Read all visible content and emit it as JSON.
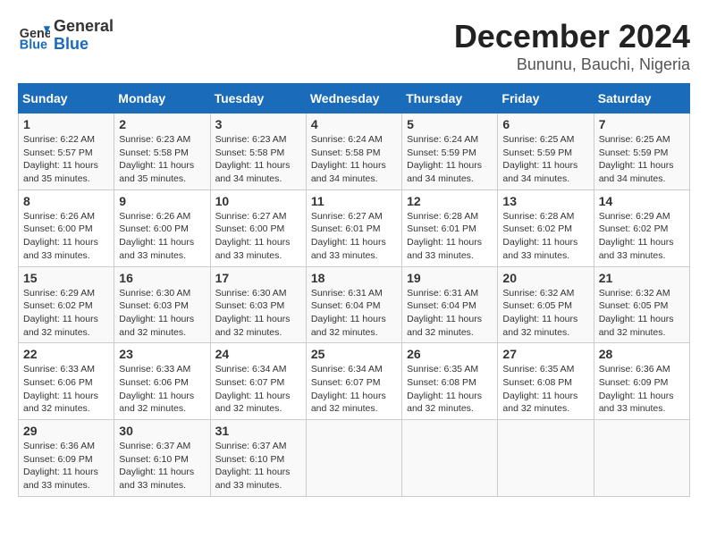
{
  "header": {
    "logo_line1": "General",
    "logo_line2": "Blue",
    "title": "December 2024",
    "subtitle": "Bununu, Bauchi, Nigeria"
  },
  "weekdays": [
    "Sunday",
    "Monday",
    "Tuesday",
    "Wednesday",
    "Thursday",
    "Friday",
    "Saturday"
  ],
  "weeks": [
    [
      {
        "day": "1",
        "sunrise": "Sunrise: 6:22 AM",
        "sunset": "Sunset: 5:57 PM",
        "daylight": "Daylight: 11 hours and 35 minutes."
      },
      {
        "day": "2",
        "sunrise": "Sunrise: 6:23 AM",
        "sunset": "Sunset: 5:58 PM",
        "daylight": "Daylight: 11 hours and 35 minutes."
      },
      {
        "day": "3",
        "sunrise": "Sunrise: 6:23 AM",
        "sunset": "Sunset: 5:58 PM",
        "daylight": "Daylight: 11 hours and 34 minutes."
      },
      {
        "day": "4",
        "sunrise": "Sunrise: 6:24 AM",
        "sunset": "Sunset: 5:58 PM",
        "daylight": "Daylight: 11 hours and 34 minutes."
      },
      {
        "day": "5",
        "sunrise": "Sunrise: 6:24 AM",
        "sunset": "Sunset: 5:59 PM",
        "daylight": "Daylight: 11 hours and 34 minutes."
      },
      {
        "day": "6",
        "sunrise": "Sunrise: 6:25 AM",
        "sunset": "Sunset: 5:59 PM",
        "daylight": "Daylight: 11 hours and 34 minutes."
      },
      {
        "day": "7",
        "sunrise": "Sunrise: 6:25 AM",
        "sunset": "Sunset: 5:59 PM",
        "daylight": "Daylight: 11 hours and 34 minutes."
      }
    ],
    [
      {
        "day": "8",
        "sunrise": "Sunrise: 6:26 AM",
        "sunset": "Sunset: 6:00 PM",
        "daylight": "Daylight: 11 hours and 33 minutes."
      },
      {
        "day": "9",
        "sunrise": "Sunrise: 6:26 AM",
        "sunset": "Sunset: 6:00 PM",
        "daylight": "Daylight: 11 hours and 33 minutes."
      },
      {
        "day": "10",
        "sunrise": "Sunrise: 6:27 AM",
        "sunset": "Sunset: 6:00 PM",
        "daylight": "Daylight: 11 hours and 33 minutes."
      },
      {
        "day": "11",
        "sunrise": "Sunrise: 6:27 AM",
        "sunset": "Sunset: 6:01 PM",
        "daylight": "Daylight: 11 hours and 33 minutes."
      },
      {
        "day": "12",
        "sunrise": "Sunrise: 6:28 AM",
        "sunset": "Sunset: 6:01 PM",
        "daylight": "Daylight: 11 hours and 33 minutes."
      },
      {
        "day": "13",
        "sunrise": "Sunrise: 6:28 AM",
        "sunset": "Sunset: 6:02 PM",
        "daylight": "Daylight: 11 hours and 33 minutes."
      },
      {
        "day": "14",
        "sunrise": "Sunrise: 6:29 AM",
        "sunset": "Sunset: 6:02 PM",
        "daylight": "Daylight: 11 hours and 33 minutes."
      }
    ],
    [
      {
        "day": "15",
        "sunrise": "Sunrise: 6:29 AM",
        "sunset": "Sunset: 6:02 PM",
        "daylight": "Daylight: 11 hours and 32 minutes."
      },
      {
        "day": "16",
        "sunrise": "Sunrise: 6:30 AM",
        "sunset": "Sunset: 6:03 PM",
        "daylight": "Daylight: 11 hours and 32 minutes."
      },
      {
        "day": "17",
        "sunrise": "Sunrise: 6:30 AM",
        "sunset": "Sunset: 6:03 PM",
        "daylight": "Daylight: 11 hours and 32 minutes."
      },
      {
        "day": "18",
        "sunrise": "Sunrise: 6:31 AM",
        "sunset": "Sunset: 6:04 PM",
        "daylight": "Daylight: 11 hours and 32 minutes."
      },
      {
        "day": "19",
        "sunrise": "Sunrise: 6:31 AM",
        "sunset": "Sunset: 6:04 PM",
        "daylight": "Daylight: 11 hours and 32 minutes."
      },
      {
        "day": "20",
        "sunrise": "Sunrise: 6:32 AM",
        "sunset": "Sunset: 6:05 PM",
        "daylight": "Daylight: 11 hours and 32 minutes."
      },
      {
        "day": "21",
        "sunrise": "Sunrise: 6:32 AM",
        "sunset": "Sunset: 6:05 PM",
        "daylight": "Daylight: 11 hours and 32 minutes."
      }
    ],
    [
      {
        "day": "22",
        "sunrise": "Sunrise: 6:33 AM",
        "sunset": "Sunset: 6:06 PM",
        "daylight": "Daylight: 11 hours and 32 minutes."
      },
      {
        "day": "23",
        "sunrise": "Sunrise: 6:33 AM",
        "sunset": "Sunset: 6:06 PM",
        "daylight": "Daylight: 11 hours and 32 minutes."
      },
      {
        "day": "24",
        "sunrise": "Sunrise: 6:34 AM",
        "sunset": "Sunset: 6:07 PM",
        "daylight": "Daylight: 11 hours and 32 minutes."
      },
      {
        "day": "25",
        "sunrise": "Sunrise: 6:34 AM",
        "sunset": "Sunset: 6:07 PM",
        "daylight": "Daylight: 11 hours and 32 minutes."
      },
      {
        "day": "26",
        "sunrise": "Sunrise: 6:35 AM",
        "sunset": "Sunset: 6:08 PM",
        "daylight": "Daylight: 11 hours and 32 minutes."
      },
      {
        "day": "27",
        "sunrise": "Sunrise: 6:35 AM",
        "sunset": "Sunset: 6:08 PM",
        "daylight": "Daylight: 11 hours and 32 minutes."
      },
      {
        "day": "28",
        "sunrise": "Sunrise: 6:36 AM",
        "sunset": "Sunset: 6:09 PM",
        "daylight": "Daylight: 11 hours and 33 minutes."
      }
    ],
    [
      {
        "day": "29",
        "sunrise": "Sunrise: 6:36 AM",
        "sunset": "Sunset: 6:09 PM",
        "daylight": "Daylight: 11 hours and 33 minutes."
      },
      {
        "day": "30",
        "sunrise": "Sunrise: 6:37 AM",
        "sunset": "Sunset: 6:10 PM",
        "daylight": "Daylight: 11 hours and 33 minutes."
      },
      {
        "day": "31",
        "sunrise": "Sunrise: 6:37 AM",
        "sunset": "Sunset: 6:10 PM",
        "daylight": "Daylight: 11 hours and 33 minutes."
      },
      {
        "day": "",
        "sunrise": "",
        "sunset": "",
        "daylight": ""
      },
      {
        "day": "",
        "sunrise": "",
        "sunset": "",
        "daylight": ""
      },
      {
        "day": "",
        "sunrise": "",
        "sunset": "",
        "daylight": ""
      },
      {
        "day": "",
        "sunrise": "",
        "sunset": "",
        "daylight": ""
      }
    ]
  ]
}
